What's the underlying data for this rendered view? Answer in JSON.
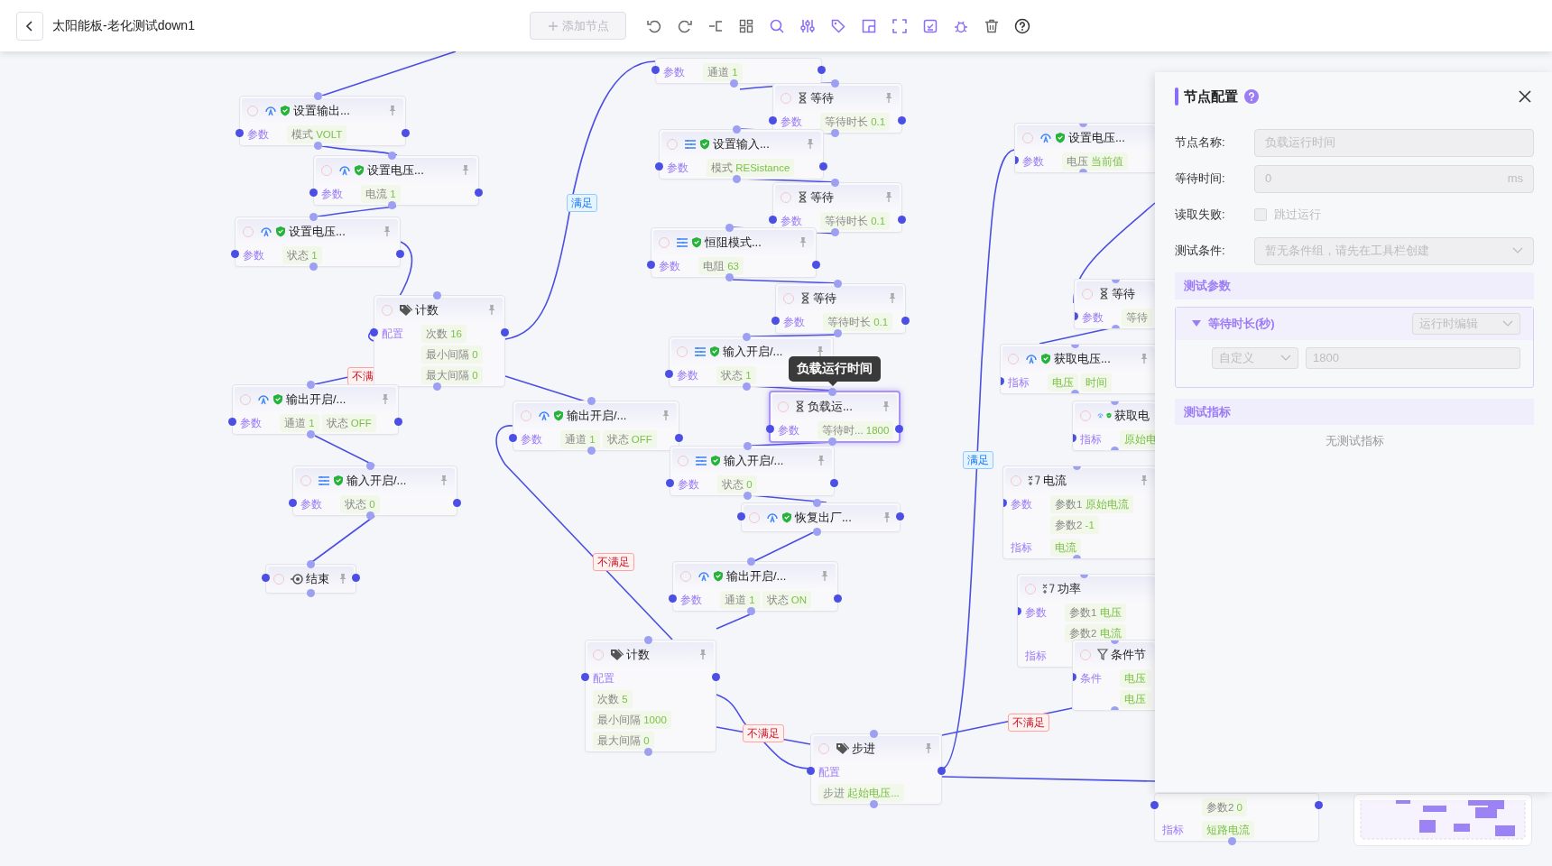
{
  "toolbar": {
    "title": "太阳能板-老化测试down1",
    "add_node": {
      "label": "添加节点",
      "disabled": true
    }
  },
  "nodes": [
    {
      "selected": false,
      "sections": [
        {
          "label": "参数",
          "chips": [
            {
              "name": "通道",
              "value": "1"
            }
          ]
        }
      ]
    },
    {
      "kind": "device",
      "title": "设置输出...",
      "selected": false,
      "sections": [
        {
          "label": "参数",
          "chips": [
            {
              "name": "模式",
              "value": "VOLT"
            }
          ]
        }
      ]
    },
    {
      "kind": "device",
      "title": "设置电压...",
      "selected": false,
      "sections": [
        {
          "label": "参数",
          "chips": [
            {
              "name": "电流",
              "value": "1"
            }
          ]
        }
      ]
    },
    {
      "kind": "device",
      "title": "设置电压...",
      "selected": false,
      "sections": [
        {
          "label": "参数",
          "chips": [
            {
              "name": "状态",
              "value": "1"
            }
          ]
        }
      ]
    },
    {
      "kind": "counter",
      "title": "计数",
      "selected": false,
      "sections": [
        {
          "label": "配置",
          "chips": [
            {
              "name": "次数",
              "value": "16"
            },
            {
              "name": "最小间隔",
              "value": "0"
            },
            {
              "name": "最大间隔",
              "value": "0"
            }
          ]
        }
      ]
    },
    {
      "kind": "device",
      "title": "输出开启/...",
      "selected": false,
      "sections": [
        {
          "label": "参数",
          "chips": [
            {
              "name": "通道",
              "value": "1"
            },
            {
              "name": "状态",
              "value": "OFF"
            }
          ]
        }
      ]
    },
    {
      "kind": "input",
      "title": "输入开启/...",
      "selected": false,
      "sections": [
        {
          "label": "参数",
          "chips": [
            {
              "name": "状态",
              "value": "0"
            }
          ]
        }
      ]
    },
    {
      "kind": "end",
      "title": "结束",
      "selected": false
    },
    {
      "kind": "wait",
      "title": "等待",
      "selected": false,
      "sections": [
        {
          "label": "参数",
          "chips": [
            {
              "name": "等待时长",
              "value": "0.1"
            }
          ]
        }
      ]
    },
    {
      "kind": "input",
      "title": "设置输入...",
      "selected": false,
      "sections": [
        {
          "label": "参数",
          "chips": [
            {
              "name": "模式",
              "value": "RESistance"
            }
          ]
        }
      ]
    },
    {
      "kind": "wait",
      "title": "等待",
      "selected": false,
      "sections": [
        {
          "label": "参数",
          "chips": [
            {
              "name": "等待时长",
              "value": "0.1"
            }
          ]
        }
      ]
    },
    {
      "kind": "input",
      "title": "恒阻模式...",
      "selected": false,
      "sections": [
        {
          "label": "参数",
          "chips": [
            {
              "name": "电阻",
              "value": "63"
            }
          ]
        }
      ]
    },
    {
      "kind": "wait",
      "title": "等待",
      "selected": false,
      "sections": [
        {
          "label": "参数",
          "chips": [
            {
              "name": "等待时长",
              "value": "0.1"
            }
          ]
        }
      ]
    },
    {
      "kind": "input",
      "title": "输入开启/...",
      "selected": false,
      "sections": [
        {
          "label": "参数",
          "chips": [
            {
              "name": "状态",
              "value": "1"
            }
          ]
        }
      ]
    },
    {
      "kind": "wait",
      "title": "负载运...",
      "selected": true,
      "sections": [
        {
          "label": "参数",
          "chips": [
            {
              "name": "等待时...",
              "value": "1800"
            }
          ]
        }
      ]
    },
    {
      "kind": "device",
      "title": "输出开启/...",
      "selected": false,
      "sections": [
        {
          "label": "参数",
          "chips": [
            {
              "name": "通道",
              "value": "1"
            },
            {
              "name": "状态",
              "value": "OFF"
            }
          ]
        }
      ]
    },
    {
      "kind": "input",
      "title": "输入开启/...",
      "selected": false,
      "sections": [
        {
          "label": "参数",
          "chips": [
            {
              "name": "状态",
              "value": "0"
            }
          ]
        }
      ]
    },
    {
      "kind": "device",
      "title": "恢复出厂...",
      "selected": false
    },
    {
      "kind": "device",
      "title": "输出开启/...",
      "selected": false,
      "sections": [
        {
          "label": "参数",
          "chips": [
            {
              "name": "通道",
              "value": "1"
            },
            {
              "name": "状态",
              "value": "ON"
            }
          ]
        }
      ]
    },
    {
      "kind": "counter",
      "title": "计数",
      "selected": false,
      "sections": [
        {
          "label": "配置",
          "chips": [
            {
              "name": "次数",
              "value": "5"
            },
            {
              "name": "最小间隔",
              "value": "1000"
            },
            {
              "name": "最大间隔",
              "value": "0"
            }
          ]
        }
      ]
    },
    {
      "kind": "counter",
      "title": "步进",
      "selected": false,
      "sections": [
        {
          "label": "配置",
          "chips": [
            {
              "name": "步进",
              "value": "起始电压..."
            }
          ]
        }
      ]
    },
    {
      "kind": "device",
      "title": "设置电压...",
      "selected": false,
      "sections": [
        {
          "label": "参数",
          "chips": [
            {
              "name": "电压",
              "value": "当前值"
            }
          ]
        }
      ]
    },
    {
      "kind": "wait",
      "title": "等待",
      "selected": false,
      "sections": [
        {
          "label": "参数",
          "chips": [
            {
              "name": "等待"
            }
          ]
        }
      ]
    },
    {
      "kind": "device",
      "title": "获取电压...",
      "selected": false,
      "sections": [
        {
          "label": "指标",
          "chips": [
            {
              "value": "电压"
            },
            {
              "value": "时间"
            }
          ]
        }
      ]
    },
    {
      "kind": "device",
      "title": "获取电",
      "selected": false,
      "sections": [
        {
          "label": "指标",
          "chips": [
            {
              "value": "原始电"
            }
          ]
        }
      ]
    },
    {
      "kind": "calc",
      "title": "电流",
      "selected": false,
      "sections": [
        {
          "label": "参数",
          "chips": [
            {
              "name": "参数1",
              "value": "原始电流"
            },
            {
              "name": "参数2",
              "value": "-1"
            }
          ]
        },
        {
          "label": "指标",
          "chips": [
            {
              "value": "电流"
            }
          ]
        }
      ]
    },
    {
      "kind": "calc",
      "title": "功率",
      "selected": false,
      "sections": [
        {
          "label": "参数",
          "chips": [
            {
              "name": "参数1",
              "value": "电压"
            },
            {
              "name": "参数2",
              "value": "电流"
            }
          ]
        },
        {
          "label": "指标"
        }
      ]
    },
    {
      "kind": "condition",
      "title": "条件节",
      "selected": false,
      "sections": [
        {
          "label": "条件",
          "chips": [
            {
              "value": "电压"
            },
            {
              "value": "电压"
            }
          ]
        }
      ]
    },
    {
      "selected": false,
      "sections": [
        {
          "chips": [
            {
              "name": "参数2",
              "value": "0"
            }
          ]
        },
        {
          "label": "指标",
          "chips": [
            {
              "value": "短路电流"
            }
          ]
        }
      ]
    }
  ],
  "edge_labels": [
    {
      "text": "满足",
      "kind": "pass"
    },
    {
      "text": "不满",
      "kind": "fail"
    },
    {
      "text": "满足",
      "kind": "pass"
    },
    {
      "text": "不满足",
      "kind": "fail"
    },
    {
      "text": "不满足",
      "kind": "fail"
    },
    {
      "text": "不满足",
      "kind": "fail"
    }
  ],
  "tooltip": "负载运行时间",
  "panel": {
    "title": "节点配置",
    "fields": [
      {
        "label": "节点名称:",
        "kind": "text",
        "value": "负载运行时间",
        "disabled": true
      },
      {
        "label": "等待时间:",
        "kind": "text",
        "value": "0",
        "suffix": "ms",
        "disabled": true
      },
      {
        "label": "读取失败:",
        "kind": "checkbox",
        "option": "跳过运行",
        "checked": false,
        "disabled": true
      },
      {
        "label": "测试条件:",
        "kind": "select",
        "placeholder": "暂无条件组，请先在工具栏创建",
        "disabled": true
      }
    ],
    "sections": [
      {
        "title": "测试参数",
        "params": [
          {
            "name": "等待时长(秒)",
            "expanded": true,
            "mode": "运行时编辑",
            "source": "自定义",
            "value": "1800"
          }
        ]
      },
      {
        "title": "测试指标",
        "empty": "无测试指标"
      }
    ]
  }
}
